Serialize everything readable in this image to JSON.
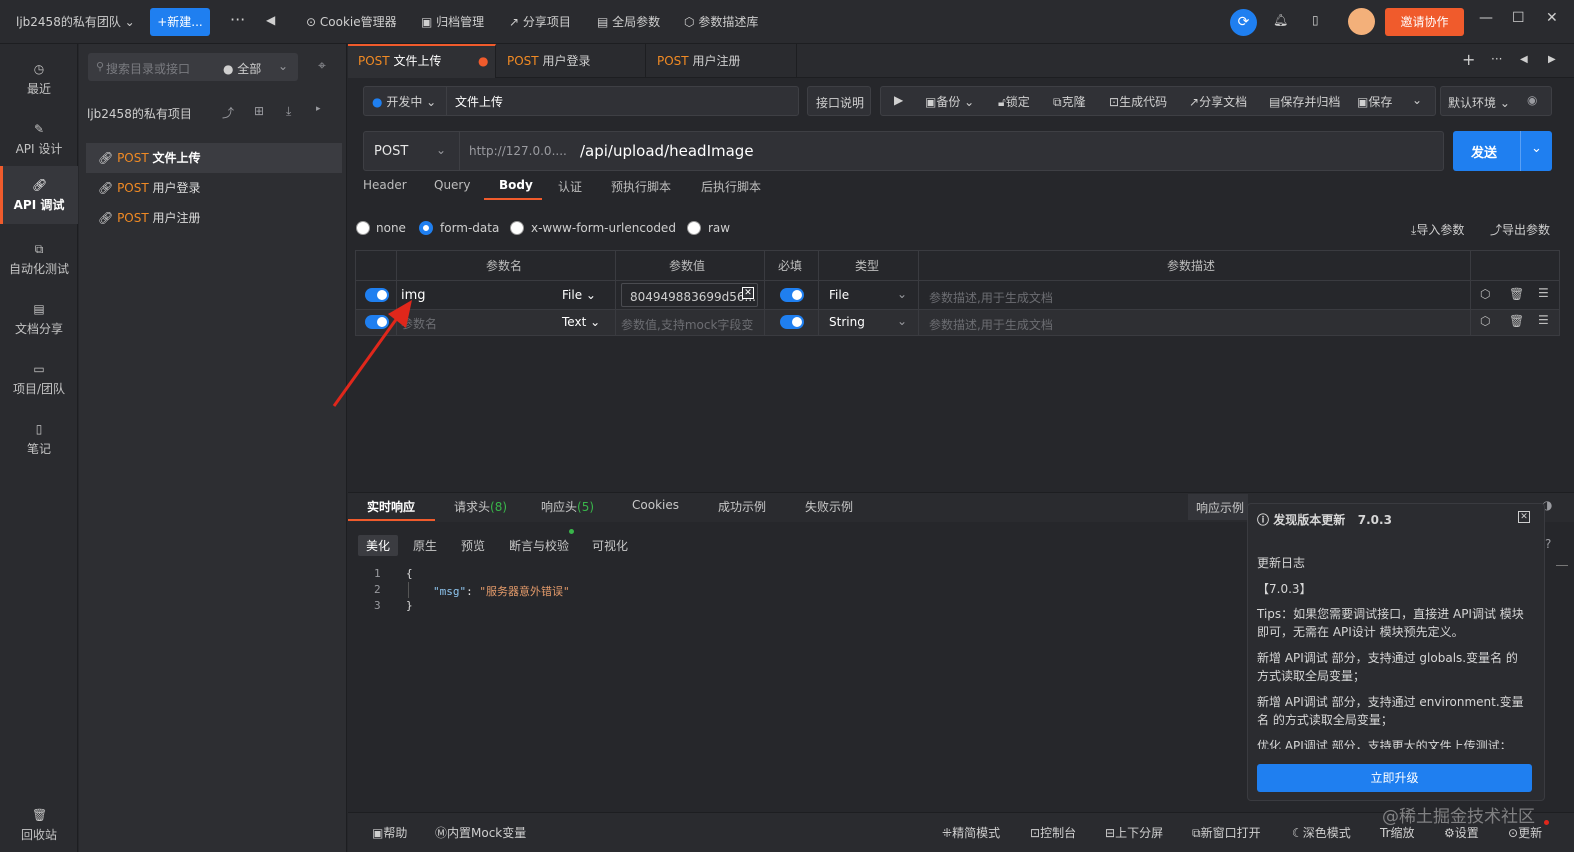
{
  "topbar": {
    "team": "ljb2458的私有团队",
    "new_button": "+新建...",
    "more": "···",
    "cookie": "Cookie管理器",
    "archive": "归档管理",
    "share": "分享项目",
    "globals": "全局参数",
    "param_lib": "参数描述库",
    "invite": "邀请协作"
  },
  "leftnav": [
    {
      "label": "最近",
      "icon": "clock-icon"
    },
    {
      "label": "API 设计",
      "icon": "edit-icon"
    },
    {
      "label": "API 调试",
      "icon": "link-icon"
    },
    {
      "label": "自动化测试",
      "icon": "flow-icon"
    },
    {
      "label": "文档分享",
      "icon": "doc-icon"
    },
    {
      "label": "项目/团队",
      "icon": "folder-icon"
    },
    {
      "label": "笔记",
      "icon": "note-icon"
    },
    {
      "label": "回收站",
      "icon": "trash-icon"
    }
  ],
  "tree": {
    "search_placeholder": "搜索目录或接口",
    "filter": "全部",
    "project": "ljb2458的私有项目",
    "items": [
      {
        "method": "POST",
        "name": "文件上传"
      },
      {
        "method": "POST",
        "name": "用户登录"
      },
      {
        "method": "POST",
        "name": "用户注册"
      }
    ]
  },
  "tabs": [
    {
      "method": "POST",
      "name": "文件上传"
    },
    {
      "method": "POST",
      "name": "用户登录"
    },
    {
      "method": "POST",
      "name": "用户注册"
    }
  ],
  "toolbar": {
    "status": "开发中",
    "name": "文件上传",
    "doc": "接口说明",
    "backup": "备份",
    "lock": "锁定",
    "clone": "克隆",
    "gen_code": "生成代码",
    "share_doc": "分享文档",
    "save_archive": "保存并归档",
    "save": "保存",
    "env": "默认环境"
  },
  "url": {
    "method": "POST",
    "host": "http://127.0.0....",
    "path": "/api/upload/headImage",
    "send": "发送"
  },
  "subtabs": [
    "Header",
    "Query",
    "Body",
    "认证",
    "预执行脚本",
    "后执行脚本"
  ],
  "body_types": [
    "none",
    "form-data",
    "x-www-form-urlencoded",
    "raw"
  ],
  "import": "导入参数",
  "export": "导出参数",
  "table": {
    "headers": [
      "参数名",
      "参数值",
      "必填",
      "类型",
      "参数描述"
    ],
    "rows": [
      {
        "name": "img",
        "kind": "File",
        "value": "804949883699d56...",
        "type": "File",
        "desc": "参数描述,用于生成文档"
      },
      {
        "name": "参数名",
        "kind": "Text",
        "value": "参数值,支持mock字段变",
        "type": "String",
        "desc": "参数描述,用于生成文档"
      }
    ]
  },
  "resp_tabs": {
    "realtime": "实时响应",
    "req_headers": "请求头",
    "req_count": "(8)",
    "resp_headers": "响应头",
    "resp_count": "(5)",
    "cookies": "Cookies",
    "success": "成功示例",
    "fail": "失败示例",
    "example": "响应示例"
  },
  "body_tabs": [
    "美化",
    "原生",
    "预览",
    "断言与校验",
    "可视化"
  ],
  "code": {
    "l1": "1",
    "l2": "2",
    "l3": "3",
    "open": "{",
    "key": "\"msg\"",
    "colon": ":",
    "val": "\"服务器意外错误\"",
    "close": "}"
  },
  "popup": {
    "title": "发现版本更新",
    "version": "7.0.3",
    "log": "更新日志",
    "tag": "【7.0.3】",
    "p1": "Tips：如果您需要调试接口，直接进 API调试 模块即可，无需在 API设计 模块预先定义。",
    "p2": "新增 API调试 部分，支持通过 globals.变量名 的方式读取全局变量；",
    "p3": "新增 API调试 部分，支持通过 environment.变量名 的方式读取全局变量；",
    "p4": "优化 API调试 部分，支持更大的文件上传测试；",
    "button": "立即升级"
  },
  "bottom": {
    "help": "帮助",
    "mock": "内置Mock变量",
    "simple": "精简模式",
    "console": "控制台",
    "split": "上下分屏",
    "newwin": "新窗口打开",
    "dark": "深色模式",
    "zoom": "缩放",
    "settings": "设置",
    "update": "更新"
  },
  "watermark": "@稀土掘金技术社区",
  "colors": {
    "accent": "#1f7ff0",
    "orange": "#f05b2c",
    "post": "#f08a24"
  }
}
